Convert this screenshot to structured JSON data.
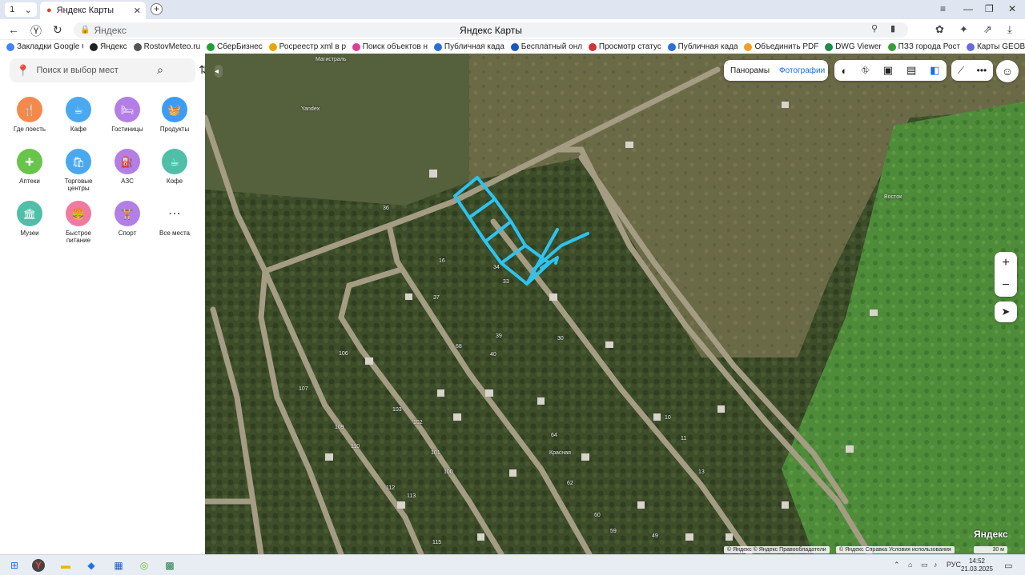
{
  "browser": {
    "tab_count": "1",
    "tab_title": "Яндекс Карты",
    "address_host": "Яндекс",
    "page_title": "Яндекс Карты"
  },
  "bookmarks": [
    {
      "label": "Закладки Google Ch",
      "color": "#4285f4"
    },
    {
      "label": "Яндекс",
      "color": "#222222"
    },
    {
      "label": "RostovMeteo.ru",
      "color": "#555555"
    },
    {
      "label": "СберБизнес",
      "color": "#21a038"
    },
    {
      "label": "Росреестр xml в р",
      "color": "#e6a800"
    },
    {
      "label": "Поиск объектов н",
      "color": "#d9409a"
    },
    {
      "label": "Публичная када",
      "color": "#2b6fd6"
    },
    {
      "label": "Бесплатный онл",
      "color": "#1a57c4"
    },
    {
      "label": "Просмотр статус",
      "color": "#d13434"
    },
    {
      "label": "Публичная када",
      "color": "#2b6fd6"
    },
    {
      "label": "Объединить PDF",
      "color": "#f0a020"
    },
    {
      "label": "DWG Viewer",
      "color": "#1e8c4a"
    },
    {
      "label": "ПЗЗ города Рост",
      "color": "#3b9c3b"
    },
    {
      "label": "Карты GEOB",
      "color": "#6b6be0"
    }
  ],
  "sidebar": {
    "search_placeholder": "Поиск и выбор мест",
    "categories": [
      {
        "label": "Где поесть",
        "icon": "🍴",
        "color": "#f5894b"
      },
      {
        "label": "Кафе",
        "icon": "☕",
        "color": "#4aa8f0"
      },
      {
        "label": "Гостиницы",
        "icon": "🛏",
        "color": "#b37ee6"
      },
      {
        "label": "Продукты",
        "icon": "🧺",
        "color": "#3b9cf5"
      },
      {
        "label": "Аптеки",
        "icon": "✚",
        "color": "#68c44a"
      },
      {
        "label": "Торговые центры",
        "icon": "🛍",
        "color": "#4aa8f0"
      },
      {
        "label": "АЗС",
        "icon": "⛽",
        "color": "#b37ee6"
      },
      {
        "label": "Кофе",
        "icon": "☕",
        "color": "#4fbfa8"
      },
      {
        "label": "Музеи",
        "icon": "🏛",
        "color": "#4fbfa8"
      },
      {
        "label": "Быстрое питание",
        "icon": "🍔",
        "color": "#f07aa0"
      },
      {
        "label": "Спорт",
        "icon": "🏋",
        "color": "#b37ee6"
      },
      {
        "label": "Все места",
        "icon": "⋯",
        "color": "#ffffff"
      }
    ]
  },
  "map": {
    "btn_panoramas": "Панорамы",
    "btn_photos": "Фотографии",
    "zoom_in": "+",
    "zoom_out": "−",
    "scale": "30 м",
    "logo": "Яндекс",
    "attribution_left": "© Яндекс © Яндекс  Правообладатели",
    "attribution_right": "© Яндекс  Справка  Условия использования",
    "labels": [
      {
        "text": "Магистраль"
      },
      {
        "text": "Восток"
      },
      {
        "text": "Yandex"
      },
      {
        "text": "36"
      },
      {
        "text": "33"
      },
      {
        "text": "34"
      },
      {
        "text": "37"
      },
      {
        "text": "106"
      },
      {
        "text": "107"
      },
      {
        "text": "109"
      },
      {
        "text": "110"
      },
      {
        "text": "112"
      },
      {
        "text": "113"
      },
      {
        "text": "115"
      },
      {
        "text": "101"
      },
      {
        "text": "102"
      },
      {
        "text": "103"
      },
      {
        "text": "100"
      },
      {
        "text": "68"
      },
      {
        "text": "40"
      },
      {
        "text": "30"
      },
      {
        "text": "39"
      },
      {
        "text": "64"
      },
      {
        "text": "62"
      },
      {
        "text": "60"
      },
      {
        "text": "59"
      },
      {
        "text": "49"
      },
      {
        "text": "11"
      },
      {
        "text": "13"
      },
      {
        "text": "10"
      },
      {
        "text": "16"
      },
      {
        "text": "Красная"
      }
    ]
  },
  "taskbar": {
    "lang": "РУС",
    "time": "14:52",
    "date": "21.03.2025"
  }
}
